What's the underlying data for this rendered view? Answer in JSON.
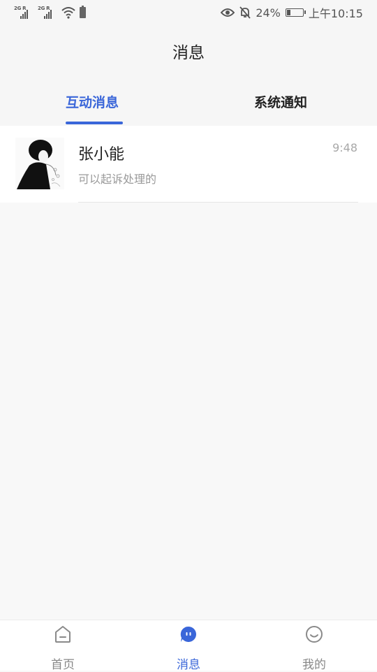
{
  "status_bar": {
    "network_1": "2G R",
    "network_2": "2G R",
    "battery_percent": "24%",
    "battery_level": 0.24,
    "time": "上午10:15"
  },
  "header": {
    "title": "消息"
  },
  "tabs": [
    {
      "label": "互动消息",
      "active": true
    },
    {
      "label": "系统通知",
      "active": false
    }
  ],
  "messages": [
    {
      "name": "张小能",
      "preview": "可以起诉处理的",
      "time": "9:48"
    }
  ],
  "bottom_nav": [
    {
      "label": "首页",
      "icon": "home-icon",
      "active": false
    },
    {
      "label": "消息",
      "icon": "message-icon",
      "active": true
    },
    {
      "label": "我的",
      "icon": "smile-icon",
      "active": false
    }
  ],
  "colors": {
    "accent": "#3a66d9",
    "background": "#f8f8f8",
    "text_primary": "#222222",
    "text_secondary": "#9a9a9a"
  }
}
